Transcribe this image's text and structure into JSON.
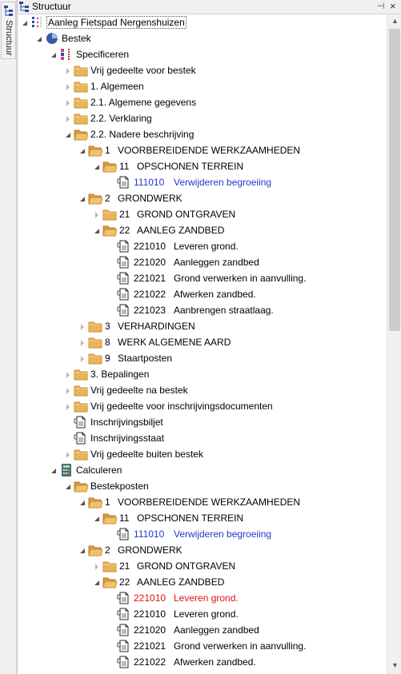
{
  "sidetab": {
    "label": "Structuur"
  },
  "panel": {
    "title": "Structuur",
    "pin_glyph": "⊣",
    "close_glyph": "×"
  },
  "tree": [
    {
      "label": "Aanleg Fietspad Nergenshuizen",
      "depth": 0,
      "icon": "structure-icon",
      "arrow": "expanded",
      "selected": true
    },
    {
      "label": "Bestek",
      "depth": 1,
      "icon": "pie-icon",
      "arrow": "expanded"
    },
    {
      "label": "Specificeren",
      "depth": 2,
      "icon": "specify-icon",
      "arrow": "expanded"
    },
    {
      "label": "Vrij gedeelte voor bestek",
      "depth": 3,
      "icon": "folder-icon",
      "arrow": "collapsed"
    },
    {
      "label": "1. Algemeen",
      "depth": 3,
      "icon": "folder-icon",
      "arrow": "collapsed"
    },
    {
      "label": "2.1. Algemene gegevens",
      "depth": 3,
      "icon": "folder-icon",
      "arrow": "collapsed"
    },
    {
      "label": "2.2. Verklaring",
      "depth": 3,
      "icon": "folder-icon",
      "arrow": "collapsed"
    },
    {
      "label": "2.2. Nadere beschrijving",
      "depth": 3,
      "icon": "folder-open-icon",
      "arrow": "expanded"
    },
    {
      "code": "1",
      "label": "VOORBEREIDENDE WERKZAAMHEDEN",
      "depth": 4,
      "icon": "folder-open-icon",
      "arrow": "expanded"
    },
    {
      "code": "11",
      "label": "OPSCHONEN TERREIN",
      "depth": 5,
      "icon": "folder-open-icon",
      "arrow": "expanded"
    },
    {
      "code": "111010",
      "label": "Verwijderen begroeiing",
      "depth": 6,
      "icon": "document-icon",
      "arrow": "none",
      "color": "blue"
    },
    {
      "code": "2",
      "label": "GRONDWERK",
      "depth": 4,
      "icon": "folder-open-icon",
      "arrow": "expanded"
    },
    {
      "code": "21",
      "label": "GROND ONTGRAVEN",
      "depth": 5,
      "icon": "folder-icon",
      "arrow": "collapsed"
    },
    {
      "code": "22",
      "label": "AANLEG ZANDBED",
      "depth": 5,
      "icon": "folder-open-icon",
      "arrow": "expanded"
    },
    {
      "code": "221010",
      "label": "Leveren grond.",
      "depth": 6,
      "icon": "document-icon",
      "arrow": "none"
    },
    {
      "code": "221020",
      "label": "Aanleggen zandbed",
      "depth": 6,
      "icon": "document-icon",
      "arrow": "none"
    },
    {
      "code": "221021",
      "label": "Grond verwerken in aanvulling.",
      "depth": 6,
      "icon": "document-icon",
      "arrow": "none"
    },
    {
      "code": "221022",
      "label": "Afwerken zandbed.",
      "depth": 6,
      "icon": "document-icon",
      "arrow": "none"
    },
    {
      "code": "221023",
      "label": "Aanbrengen straatlaag.",
      "depth": 6,
      "icon": "document-icon",
      "arrow": "none"
    },
    {
      "code": "3",
      "label": "VERHARDINGEN",
      "depth": 4,
      "icon": "folder-icon",
      "arrow": "collapsed"
    },
    {
      "code": "8",
      "label": "WERK ALGEMENE AARD",
      "depth": 4,
      "icon": "folder-icon",
      "arrow": "collapsed"
    },
    {
      "code": "9",
      "label": "Staartposten",
      "depth": 4,
      "icon": "folder-icon",
      "arrow": "collapsed"
    },
    {
      "label": "3. Bepalingen",
      "depth": 3,
      "icon": "folder-icon",
      "arrow": "collapsed"
    },
    {
      "label": "Vrij gedeelte na bestek",
      "depth": 3,
      "icon": "folder-icon",
      "arrow": "collapsed"
    },
    {
      "label": "Vrij gedeelte voor inschrijvingsdocumenten",
      "depth": 3,
      "icon": "folder-icon",
      "arrow": "collapsed"
    },
    {
      "label": "Inschrijvingsbiljet",
      "depth": 3,
      "icon": "document-icon",
      "arrow": "none"
    },
    {
      "label": "Inschrijvingsstaat",
      "depth": 3,
      "icon": "document-icon",
      "arrow": "none"
    },
    {
      "label": "Vrij gedeelte buiten bestek",
      "depth": 3,
      "icon": "folder-icon",
      "arrow": "collapsed"
    },
    {
      "label": "Calculeren",
      "depth": 2,
      "icon": "calculator-icon",
      "arrow": "expanded"
    },
    {
      "label": "Bestekposten",
      "depth": 3,
      "icon": "folder-open-icon",
      "arrow": "expanded"
    },
    {
      "code": "1",
      "label": "VOORBEREIDENDE WERKZAAMHEDEN",
      "depth": 4,
      "icon": "folder-open-icon",
      "arrow": "expanded"
    },
    {
      "code": "11",
      "label": "OPSCHONEN TERREIN",
      "depth": 5,
      "icon": "folder-open-icon",
      "arrow": "expanded"
    },
    {
      "code": "111010",
      "label": "Verwijderen begroeiing",
      "depth": 6,
      "icon": "document-icon",
      "arrow": "none",
      "color": "blue"
    },
    {
      "code": "2",
      "label": "GRONDWERK",
      "depth": 4,
      "icon": "folder-open-icon",
      "arrow": "expanded"
    },
    {
      "code": "21",
      "label": "GROND ONTGRAVEN",
      "depth": 5,
      "icon": "folder-icon",
      "arrow": "collapsed"
    },
    {
      "code": "22",
      "label": "AANLEG ZANDBED",
      "depth": 5,
      "icon": "folder-open-icon",
      "arrow": "expanded"
    },
    {
      "code": "221010",
      "label": "Leveren grond.",
      "depth": 6,
      "icon": "document-icon",
      "arrow": "none",
      "color": "red"
    },
    {
      "code": "221010",
      "label": "Leveren grond.",
      "depth": 6,
      "icon": "document-icon",
      "arrow": "none"
    },
    {
      "code": "221020",
      "label": "Aanleggen zandbed",
      "depth": 6,
      "icon": "document-icon",
      "arrow": "none"
    },
    {
      "code": "221021",
      "label": "Grond verwerken in aanvulling.",
      "depth": 6,
      "icon": "document-icon",
      "arrow": "none"
    },
    {
      "code": "221022",
      "label": "Afwerken zandbed.",
      "depth": 6,
      "icon": "document-icon",
      "arrow": "none"
    }
  ],
  "colors": {
    "blue": "#2338c9",
    "red": "#e01010",
    "folder": "#e9b45a"
  }
}
